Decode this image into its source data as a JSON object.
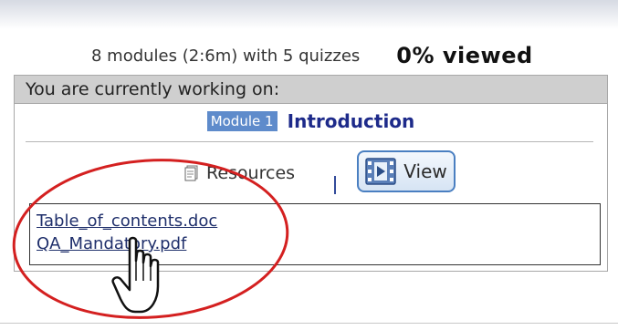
{
  "summary": {
    "modules_text": "8 modules (2:6m) with 5 quizzes",
    "viewed_percent": "0% viewed"
  },
  "panel": {
    "header": "You are currently working on:",
    "module_badge": "Module 1",
    "module_title": "Introduction",
    "resources_label": "Resources",
    "resources_icon": "document-icon",
    "view_label": "View",
    "view_icon": "play-film-icon",
    "files": [
      {
        "name": "Table_of_contents.doc"
      },
      {
        "name": "QA_Mandatory.pdf"
      }
    ]
  },
  "annotation": {
    "circle_color": "#d42020",
    "cursor": "hand-pointer-icon"
  }
}
